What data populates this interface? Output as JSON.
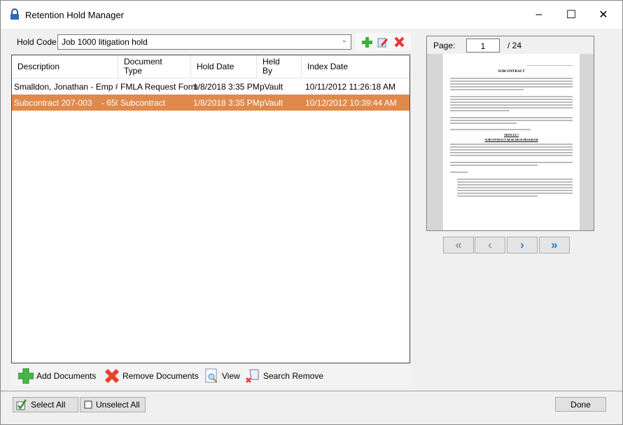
{
  "window": {
    "title": "Retention Hold Manager"
  },
  "hold": {
    "label": "Hold Code",
    "value": "Job 1000 litigation hold"
  },
  "columns": [
    "Description",
    "Document Type",
    "Hold Date",
    "Held By",
    "Index Date"
  ],
  "columns_split": [
    [
      "Description",
      ""
    ],
    [
      "Document",
      "Type"
    ],
    [
      "Hold Date",
      ""
    ],
    [
      "Held",
      "By"
    ],
    [
      "Index Date",
      ""
    ]
  ],
  "rows": [
    {
      "description": "Smalldon, Jonathan - Emp #...",
      "type": "FMLA Request Form",
      "hold_date": "1/8/2018 3:35 PM",
      "held_by": "pVault",
      "index_date": "10/11/2012 11:26:18 AM",
      "selected": false
    },
    {
      "description": "Subcontract 207-003    - 650...",
      "type": "Subcontract",
      "hold_date": "1/8/2018 3:35 PM",
      "held_by": "pVault",
      "index_date": "10/12/2012 10:39:44 AM",
      "selected": true
    }
  ],
  "toolbar": {
    "add": "Add Documents",
    "remove": "Remove Documents",
    "view": "View",
    "search_remove": "Search Remove"
  },
  "bottom": {
    "select_all": "Select All",
    "unselect_all": "Unselect All",
    "done": "Done"
  },
  "preview": {
    "page_label": "Page:",
    "page": "1",
    "total": "/ 24",
    "doc_title": "SUBCONTRACT",
    "article": "ARTICLE 1",
    "section": "SUBCONTRACT RESEARCH PROGRAM"
  },
  "colors": {
    "selected_row": "#e0894a",
    "nav_active": "#1e7fd6"
  }
}
